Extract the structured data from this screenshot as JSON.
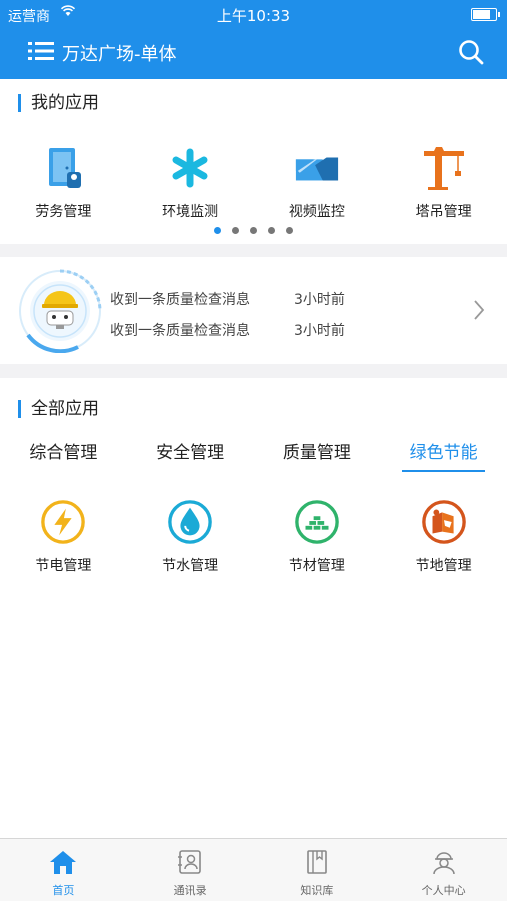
{
  "status": {
    "carrier": "运营商",
    "time": "上午10:33",
    "battery_level": 0.85
  },
  "nav": {
    "title": "万达广场-单体"
  },
  "my_apps": {
    "title": "我的应用",
    "items": [
      {
        "label": "劳务管理",
        "icon": "door-worker-icon"
      },
      {
        "label": "环境监测",
        "icon": "asterisk-icon"
      },
      {
        "label": "视频监控",
        "icon": "camera-icon"
      },
      {
        "label": "塔吊管理",
        "icon": "tower-crane-icon"
      }
    ],
    "page_count": 5,
    "active_page": 1
  },
  "messages": [
    {
      "text": "收到一条质量检查消息",
      "time": "3小时前"
    },
    {
      "text": "收到一条质量检查消息",
      "time": "3小时前"
    }
  ],
  "all_apps": {
    "title": "全部应用",
    "tabs": [
      "综合管理",
      "安全管理",
      "质量管理",
      "绿色节能"
    ],
    "active_tab": 3,
    "items": [
      {
        "label": "节电管理",
        "icon": "lightning-icon"
      },
      {
        "label": "节水管理",
        "icon": "water-drop-icon"
      },
      {
        "label": "节材管理",
        "icon": "bricks-icon"
      },
      {
        "label": "节地管理",
        "icon": "land-icon"
      }
    ]
  },
  "tabbar": [
    {
      "label": "首页",
      "icon": "home-icon"
    },
    {
      "label": "通讯录",
      "icon": "contacts-icon"
    },
    {
      "label": "知识库",
      "icon": "book-icon"
    },
    {
      "label": "个人中心",
      "icon": "worker-profile-icon"
    }
  ],
  "colors": {
    "primary": "#1f8fea",
    "orange": "#e8721c",
    "cyan": "#1bb8e0",
    "green": "#2fb36b",
    "yellow": "#f2b31b"
  }
}
